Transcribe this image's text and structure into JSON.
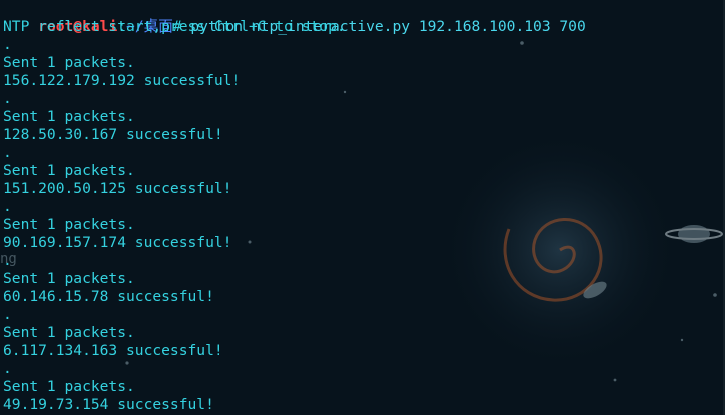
{
  "prompt": {
    "user_host": "root@kali",
    "separator": ":",
    "path": "~/桌面",
    "symbol": "#",
    "command": " python ntp_interactive.py 192.168.100.103 700"
  },
  "output_lines": [
    "NTP reflect start,press Ctrl+C to stop.",
    ".",
    "Sent 1 packets.",
    "156.122.179.192 successful!",
    ".",
    "Sent 1 packets.",
    "128.50.30.167 successful!",
    ".",
    "Sent 1 packets.",
    "151.200.50.125 successful!",
    ".",
    "Sent 1 packets.",
    "90.169.157.174 successful!",
    ".",
    "Sent 1 packets.",
    "60.146.15.78 successful!",
    ".",
    "Sent 1 packets.",
    "6.117.134.163 successful!",
    ".",
    "Sent 1 packets.",
    "49.19.73.154 successful!"
  ],
  "background_stray_text": "ng",
  "colors": {
    "background": "#07131c",
    "prompt_user": "#ff4b4b",
    "prompt_path": "#4f86ff",
    "output_text": "#35d2e0"
  }
}
